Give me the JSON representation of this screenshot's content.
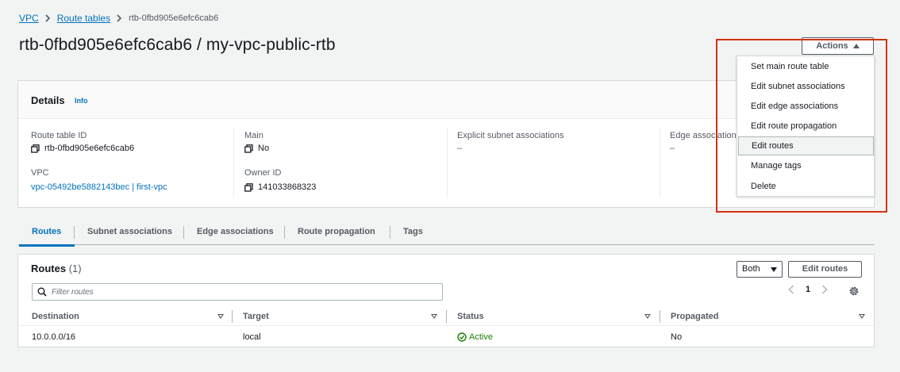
{
  "breadcrumb": {
    "items": [
      "VPC",
      "Route tables"
    ],
    "current": "rtb-0fbd905e6efc6cab6"
  },
  "page_title": "rtb-0fbd905e6efc6cab6 / my-vpc-public-rtb",
  "actions_label": "Actions",
  "actions_menu": [
    "Set main route table",
    "Edit subnet associations",
    "Edit edge associations",
    "Edit route propagation",
    "Edit routes",
    "Manage tags",
    "Delete"
  ],
  "details": {
    "title": "Details",
    "info": "Info",
    "route_table_id_label": "Route table ID",
    "route_table_id": "rtb-0fbd905e6efc6cab6",
    "main_label": "Main",
    "main_value": "No",
    "explicit_label": "Explicit subnet associations",
    "explicit_value": "–",
    "edge_label": "Edge associations",
    "edge_value": "–",
    "vpc_label": "VPC",
    "vpc_value": "vpc-05492be5882143bec | first-vpc",
    "owner_label": "Owner ID",
    "owner_value": "141033868323"
  },
  "tabs": [
    "Routes",
    "Subnet associations",
    "Edge associations",
    "Route propagation",
    "Tags"
  ],
  "routes": {
    "title": "Routes",
    "count": "(1)",
    "filter_select": "Both",
    "edit_button": "Edit routes",
    "filter_placeholder": "Filter routes",
    "page": "1",
    "columns": [
      "Destination",
      "Target",
      "Status",
      "Propagated"
    ],
    "rows": [
      {
        "destination": "10.0.0.0/16",
        "target": "local",
        "status": "Active",
        "propagated": "No"
      }
    ]
  },
  "colors": {
    "link": "#0073bb",
    "status_active": "#1d8102",
    "highlight": "#d13212"
  }
}
